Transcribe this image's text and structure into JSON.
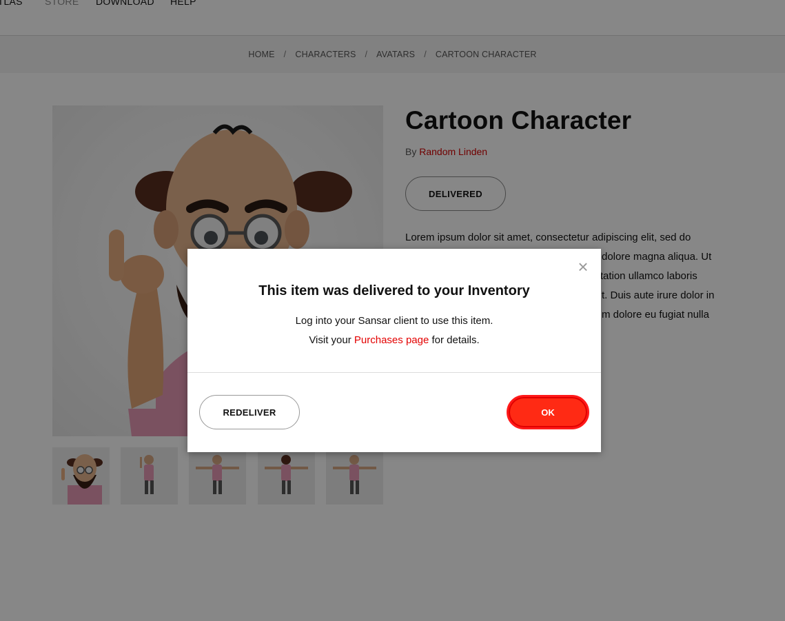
{
  "nav": {
    "items": [
      {
        "label": "ATLAS",
        "muted": false
      },
      {
        "label": "STORE",
        "muted": true
      },
      {
        "label": "DOWNLOAD",
        "muted": false
      },
      {
        "label": "HELP",
        "muted": false
      }
    ]
  },
  "breadcrumb": {
    "items": [
      "HOME",
      "CHARACTERS",
      "AVATARS",
      "CARTOON CHARACTER"
    ],
    "separator": "/"
  },
  "product": {
    "title": "Cartoon Character",
    "by_prefix": "By",
    "author": "Random Linden",
    "status_button": "DELIVERED",
    "description_lines": [
      "Lorem ipsum dolor sit amet, consectetur adipiscing elit, sed do",
      "dolore magna aliqua. Ut",
      "rcitation ullamco laboris",
      "t. Duis aute irure dolor in",
      "m dolore eu fugiat nulla"
    ],
    "thumbnail_count": 5
  },
  "modal": {
    "title": "This item was delivered to your Inventory",
    "line1": "Log into your Sansar client to use this item.",
    "line2_prefix": "Visit your",
    "line2_link": "Purchases page",
    "line2_suffix": "for details.",
    "redeliver_label": "REDELIVER",
    "ok_label": "OK",
    "close_glyph": "×"
  },
  "colors": {
    "accent_red": "#e30000",
    "ok_button": "#ff2a14",
    "overlay": "rgba(0,0,0,0.47)"
  }
}
